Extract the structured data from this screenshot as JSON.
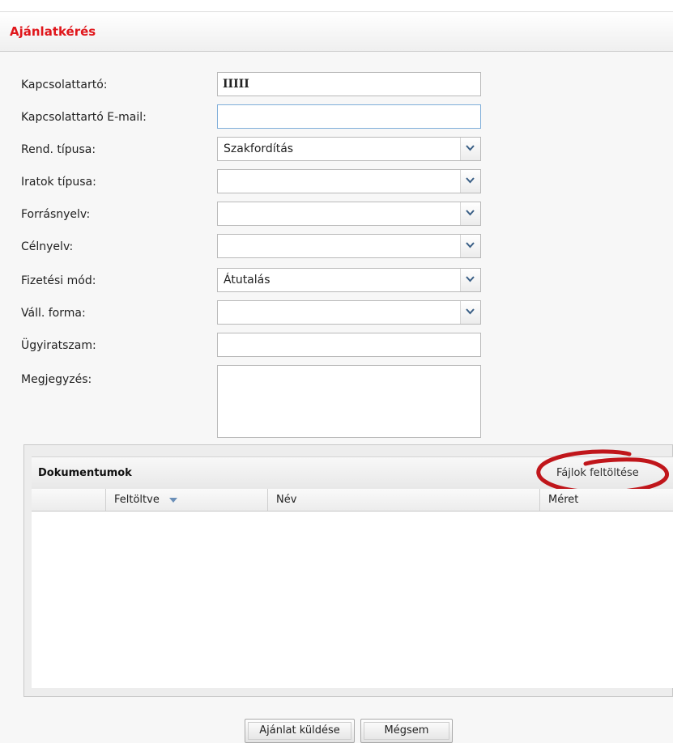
{
  "header": {
    "title": "Ajánlatkérés"
  },
  "form": {
    "contact": {
      "label": "Kapcsolattartó:",
      "value": "IIIII"
    },
    "email": {
      "label": "Kapcsolattartó E-mail:",
      "value": ""
    },
    "order_type": {
      "label": "Rend. típusa:",
      "value": "Szakfordítás"
    },
    "doc_type": {
      "label": "Iratok típusa:",
      "value": ""
    },
    "source_lang": {
      "label": "Forrásnyelv:",
      "value": ""
    },
    "target_lang": {
      "label": "Célnyelv:",
      "value": ""
    },
    "payment": {
      "label": "Fizetési mód:",
      "value": "Átutalás"
    },
    "company_form": {
      "label": "Váll. forma:",
      "value": ""
    },
    "case_number": {
      "label": "Ügyiratszam:",
      "value": ""
    },
    "note": {
      "label": "Megjegyzés:",
      "value": ""
    }
  },
  "documents": {
    "title": "Dokumentumok",
    "upload_label": "Fájlok feltöltése",
    "columns": {
      "uploaded": "Feltöltve",
      "name": "Név",
      "size": "Méret"
    },
    "highlight_color": "#c0161b"
  },
  "actions": {
    "submit_label": "Ajánlat küldése",
    "cancel_label": "Mégsem"
  }
}
